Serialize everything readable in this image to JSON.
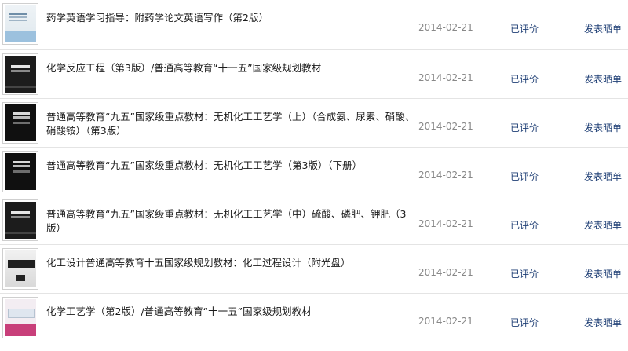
{
  "orders": [
    {
      "cover_icon": "book-cover-light",
      "title": "药学英语学习指导：附药学论文英语写作（第2版）",
      "date": "2014-02-21",
      "status": "已评价",
      "action": "发表晒单"
    },
    {
      "cover_icon": "book-cover-dark",
      "title": "化学反应工程（第3版）/普通高等教育“十一五”国家级规划教材",
      "date": "2014-02-21",
      "status": "已评价",
      "action": "发表晒单"
    },
    {
      "cover_icon": "book-cover-dark",
      "title": "普通高等教育“九五”国家级重点教材：无机化工工艺学（上）（合成氨、尿素、硝酸、硝酸铵）（第3版）",
      "date": "2014-02-21",
      "status": "已评价",
      "action": "发表晒单"
    },
    {
      "cover_icon": "book-cover-dark",
      "title": "普通高等教育“九五”国家级重点教材：无机化工工艺学（第3版）（下册）",
      "date": "2014-02-21",
      "status": "已评价",
      "action": "发表晒单"
    },
    {
      "cover_icon": "book-cover-dark",
      "title": "普通高等教育“九五”国家级重点教材：无机化工工艺学（中）硫酸、磷肥、钾肥（3版）",
      "date": "2014-02-21",
      "status": "已评价",
      "action": "发表晒单"
    },
    {
      "cover_icon": "book-cover-grey",
      "title": "化工设计普通高等教育十五国家级规划教材：化工过程设计（附光盘）",
      "date": "2014-02-21",
      "status": "已评价",
      "action": "发表晒单"
    },
    {
      "cover_icon": "book-cover-pink",
      "title": "化学工艺学（第2版）/普通高等教育“十一五”国家级规划教材",
      "date": "2014-02-21",
      "status": "已评价",
      "action": "发表晒单"
    }
  ]
}
